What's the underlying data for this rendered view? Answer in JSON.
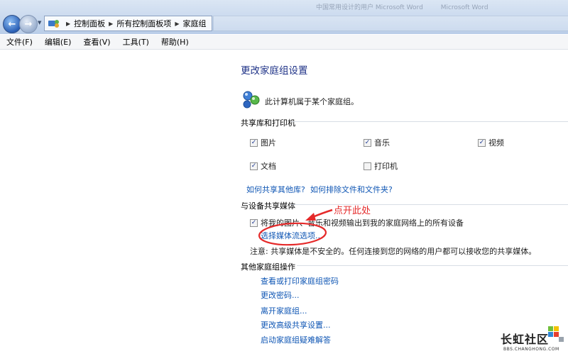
{
  "window": {
    "title_right": [
      "中国常用设计的用户 Microsoft Word",
      "Microsoft Word"
    ]
  },
  "address_bar": {
    "breadcrumbs": [
      "控制面板",
      "所有控制面板项",
      "家庭组"
    ]
  },
  "menu": [
    "文件(F)",
    "编辑(E)",
    "查看(V)",
    "工具(T)",
    "帮助(H)"
  ],
  "content": {
    "title": "更改家庭组设置",
    "status": "此计算机属于某个家庭组。",
    "share_section": {
      "label": "共享库和打印机",
      "items": [
        {
          "label": "图片",
          "checked": true
        },
        {
          "label": "音乐",
          "checked": true
        },
        {
          "label": "视频",
          "checked": true
        },
        {
          "label": "文档",
          "checked": true
        },
        {
          "label": "打印机",
          "checked": false
        }
      ],
      "links": [
        "如何共享其他库?",
        "如何排除文件和文件夹?"
      ]
    },
    "media_section": {
      "label": "与设备共享媒体",
      "checkbox_label": "将我的图片、音乐和视频输出到我的家庭网络上的所有设备",
      "checkbox_checked": true,
      "link": "选择媒体流选项...",
      "note": "注意: 共享媒体是不安全的。任何连接到您的网络的用户都可以接收您的共享媒体。"
    },
    "other_section": {
      "label": "其他家庭组操作",
      "links": [
        "查看或打印家庭组密码",
        "更改密码...",
        "离开家庭组...",
        "更改高级共享设置...",
        "启动家庭组疑难解答"
      ]
    }
  },
  "annotation": {
    "text": "点开此处",
    "color": "#e52a2a"
  },
  "watermark": {
    "main": "长虹社区",
    "sub": "BBS.CHANGHONG.COM"
  }
}
